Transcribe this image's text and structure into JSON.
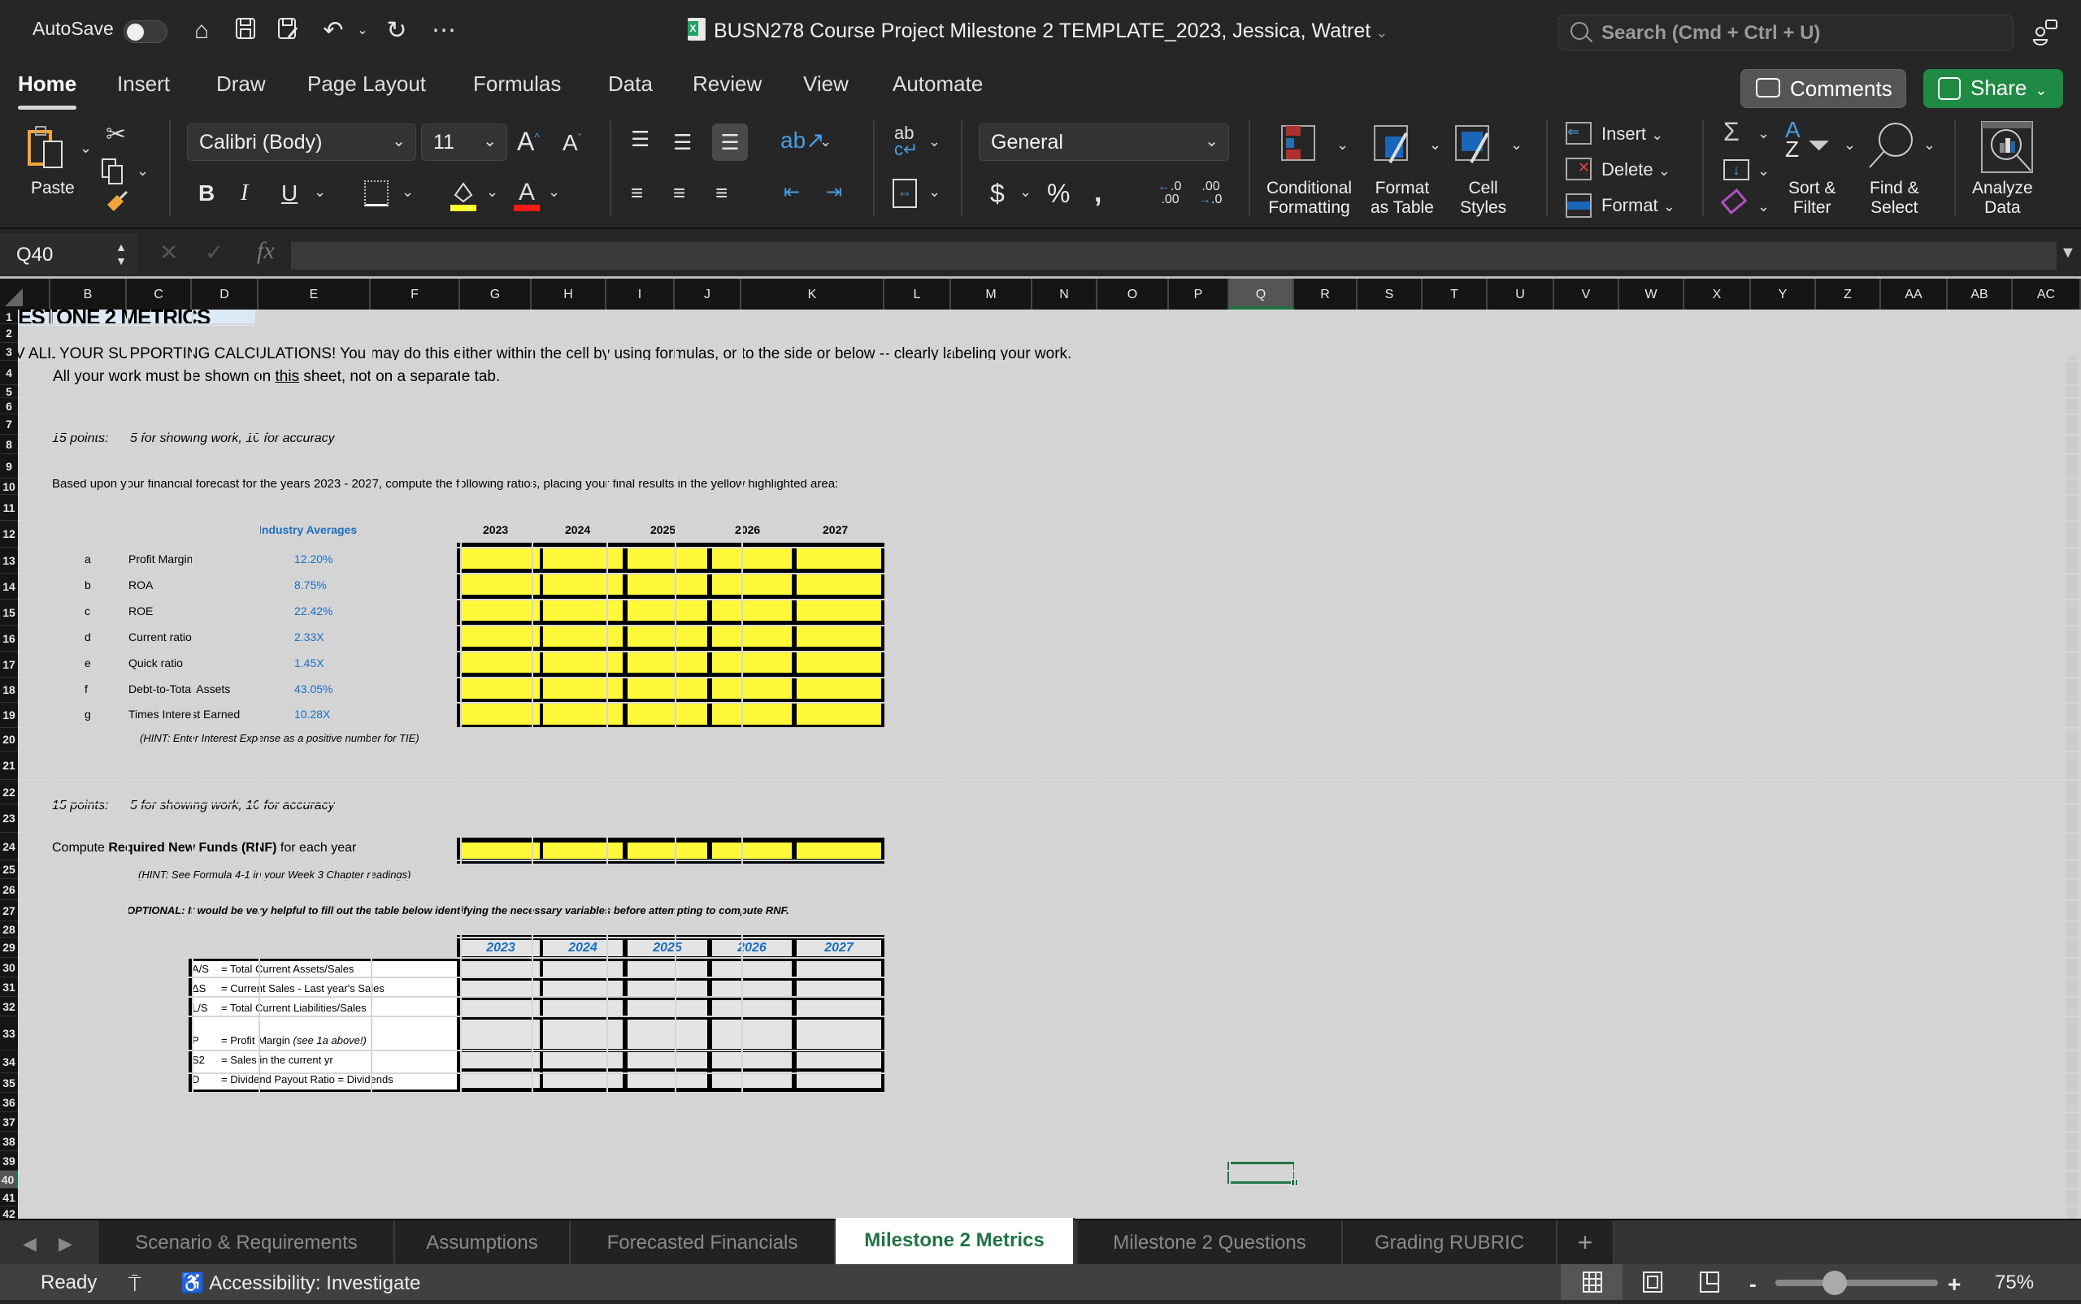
{
  "titlebar": {
    "autosave_label": "AutoSave",
    "autosave_on": false,
    "document_title": "BUSN278 Course Project Milestone 2 TEMPLATE_2023, Jessica, Watret",
    "search_placeholder": "Search (Cmd + Ctrl + U)",
    "icons": [
      "home-icon",
      "save-icon",
      "save-as-icon",
      "undo-icon",
      "redo-icon",
      "more-icon",
      "share-people-icon"
    ]
  },
  "menu": {
    "tabs": [
      "Home",
      "Insert",
      "Draw",
      "Page Layout",
      "Formulas",
      "Data",
      "Review",
      "View",
      "Automate"
    ],
    "active_tab": "Home",
    "comments_label": "Comments",
    "share_label": "Share"
  },
  "ribbon": {
    "paste_label": "Paste",
    "font_name": "Calibri (Body)",
    "font_size": "11",
    "number_format": "General",
    "conditional_formatting": "Conditional\nFormatting",
    "conditional_formatting_l1": "Conditional",
    "conditional_formatting_l2": "Formatting",
    "format_as_table_l1": "Format",
    "format_as_table_l2": "as Table",
    "cell_styles_l1": "Cell",
    "cell_styles_l2": "Styles",
    "insert_label": "Insert",
    "delete_label": "Delete",
    "format_label": "Format",
    "sort_filter_l1": "Sort &",
    "sort_filter_l2": "Filter",
    "find_select_l1": "Find &",
    "find_select_l2": "Select",
    "analyze_l1": "Analyze",
    "analyze_l2": "Data",
    "colors": {
      "fill": "#ffff33",
      "font": "#ff1a1a",
      "accent": "#217346"
    }
  },
  "formula_bar": {
    "name_box": "Q40",
    "formula": ""
  },
  "grid": {
    "columns": [
      "",
      "B",
      "C",
      "D",
      "E",
      "F",
      "G",
      "H",
      "I",
      "J",
      "K",
      "L",
      "M",
      "N",
      "O",
      "P",
      "Q",
      "R",
      "S",
      "T",
      "U",
      "V",
      "W",
      "X",
      "Y",
      "Z",
      "AA",
      "AB",
      "AC"
    ],
    "selected_column": "Q",
    "rows": [
      "1",
      "2",
      "3",
      "4",
      "5",
      "6",
      "7",
      "8",
      "9",
      "10",
      "11",
      "12",
      "13",
      "14",
      "15",
      "16",
      "17",
      "18",
      "19",
      "20",
      "21",
      "22",
      "23",
      "24",
      "25",
      "26",
      "27",
      "28",
      "29",
      "30",
      "31",
      "32",
      "33",
      "34",
      "35",
      "36",
      "37",
      "38",
      "39",
      "40",
      "41",
      "42"
    ],
    "selected_row": "40",
    "selected_cell": "Q40"
  },
  "sheet": {
    "title": "ESTONE 2 METRICS",
    "instruction_line1": "V ALL YOUR SUPPORTING CALCULATIONS!  You may do this either within the cell by using formulas, or to the side or below -- clearly labeling your work.",
    "instruction_line2_pre": "All your work must be shown on ",
    "instruction_line2_u": "this",
    "instruction_line2_post": " sheet, not on a separate tab.",
    "points1_label": "15 points:",
    "points1_desc": "5 for showing work, 10 for accuracy",
    "based_upon": "Based upon your financial forecast for the years 2023 - 2027, compute the following ratios, placing your final results in the yellow highlighted area:",
    "industry_averages_header": "Industry Averages",
    "years": [
      "2023",
      "2024",
      "2025",
      "2026",
      "2027"
    ],
    "ratios": [
      {
        "letter": "a",
        "name": "Profit Margin",
        "avg": "12.20%"
      },
      {
        "letter": "b",
        "name": "ROA",
        "avg": "8.75%"
      },
      {
        "letter": "c",
        "name": "ROE",
        "avg": "22.42%"
      },
      {
        "letter": "d",
        "name": "Current ratio",
        "avg": "2.33X"
      },
      {
        "letter": "e",
        "name": "Quick ratio",
        "avg": "1.45X"
      },
      {
        "letter": "f",
        "name": "Debt-to-Total Assets",
        "avg": "43.05%"
      },
      {
        "letter": "g",
        "name": "Times Interest Earned",
        "avg": "10.28X"
      }
    ],
    "hint_tie": "(HINT: Enter Interest Expense as a positive number for TIE)",
    "points2_label": "15 points:",
    "points2_desc": "5 for showing work, 10 for accuracy",
    "rnf_pre": "Compute ",
    "rnf_bold": "Required New Funds (RNF)",
    "rnf_post": " for each year",
    "hint_rnf": "(HINT: See Formula 4-1 in your Week 3 Chapter readings)",
    "optional_note": "OPTIONAL:  It would be very helpful to fill out the table below identifying the necessary variables before attempting to compute RNF.",
    "variables": [
      {
        "sym": "A/S",
        "def": "= Total Current Assets/Sales",
        "note": ""
      },
      {
        "sym": "ΔS",
        "def": "= Current Sales - Last year's Sales",
        "note": ""
      },
      {
        "sym": "L/S",
        "def": "= Total Current Liabilities/Sales",
        "note": ""
      },
      {
        "sym": "P",
        "def": "= Profit Margin ",
        "note": "(see 1a above!)"
      },
      {
        "sym": "S2",
        "def": "= Sales in the current yr",
        "note": ""
      },
      {
        "sym": "D",
        "def": "= Dividend Payout Ratio = Dividends",
        "note": ""
      }
    ],
    "colors": {
      "highlight": "#fff93a",
      "industry_blue": "#1a6fc0",
      "input_gray": "#e4e4e4",
      "title_band": "#dde9f5"
    }
  },
  "sheet_tabs": {
    "tabs": [
      "Scenario & Requirements",
      "Assumptions",
      "Forecasted Financials",
      "Milestone 2 Metrics",
      "Milestone 2 Questions",
      "Grading RUBRIC"
    ],
    "active": "Milestone 2 Metrics",
    "add_label": "+"
  },
  "status": {
    "ready": "Ready",
    "accessibility": "Accessibility: Investigate",
    "zoom": "75%",
    "zoom_minus": "-",
    "zoom_plus": "+"
  }
}
